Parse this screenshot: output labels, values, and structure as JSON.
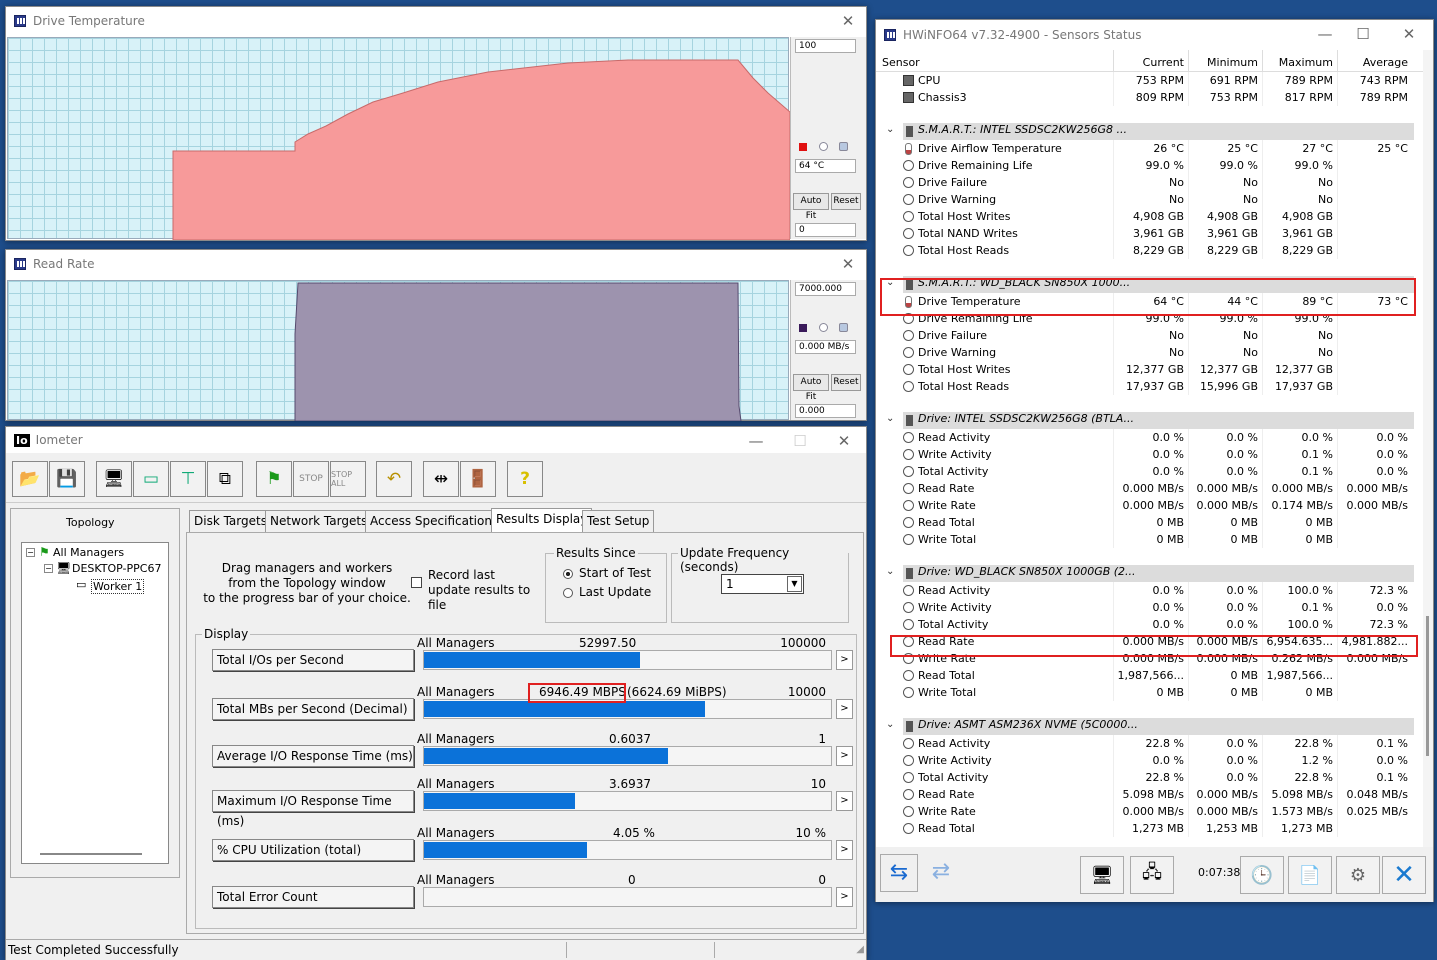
{
  "drive_temp": {
    "title": "Drive Temperature",
    "scale_max": "100",
    "scale_min": "0",
    "current": "64 °C",
    "auto_fit": "Auto Fit",
    "reset": "Reset",
    "color": "#f79a9a"
  },
  "read_rate": {
    "title": "Read Rate",
    "scale_max": "7000.000",
    "scale_min": "0.000",
    "current": "0.000 MB/s",
    "auto_fit": "Auto Fit",
    "reset": "Reset",
    "color": "#9d93ae"
  },
  "iometer": {
    "title": "Iometer",
    "logo": "Io",
    "topology_label": "Topology",
    "tree": [
      "All Managers",
      "DESKTOP-PPC67",
      "Worker 1"
    ],
    "tabs": [
      "Disk Targets",
      "Network Targets",
      "Access Specifications",
      "Results Display",
      "Test Setup"
    ],
    "drag_text": [
      "Drag managers and workers",
      "from the Topology window",
      "to the progress bar of your choice."
    ],
    "record_label": "Record last update results to file",
    "results_since_label": "Results Since",
    "start_label": "Start of Test",
    "last_update_label": "Last Update",
    "update_freq_label": "Update Frequency (seconds)",
    "update_freq_value": "1",
    "display_label": "Display",
    "status": "Test Completed Successfully",
    "metrics": [
      {
        "name": "Total I/Os per Second",
        "scope": "All Managers",
        "value": "52997.50",
        "max": "100000",
        "fill": 0.53
      },
      {
        "name": "Total MBs per Second (Decimal)",
        "scope": "All Managers",
        "value": "6946.49 MBPS",
        "extra": "(6624.69 MiBPS)",
        "max": "10000",
        "fill": 0.69
      },
      {
        "name": "Average I/O Response Time (ms)",
        "scope": "All Managers",
        "value": "0.6037",
        "max": "1",
        "fill": 0.6
      },
      {
        "name": "Maximum I/O Response Time (ms)",
        "scope": "All Managers",
        "value": "3.6937",
        "max": "10",
        "fill": 0.37
      },
      {
        "name": "% CPU Utilization (total)",
        "scope": "All Managers",
        "value": "4.05 %",
        "max": "10 %",
        "fill": 0.4
      },
      {
        "name": "Total Error Count",
        "scope": "All Managers",
        "value": "0",
        "max": "0",
        "fill": 0
      }
    ]
  },
  "hwinfo": {
    "title": "HWiNFO64 v7.32-4900 - Sensors Status",
    "columns": [
      "Sensor",
      "Current",
      "Minimum",
      "Maximum",
      "Average"
    ],
    "timer": "0:07:38",
    "rows": [
      {
        "t": "s",
        "n": "CPU",
        "v": [
          "753 RPM",
          "691 RPM",
          "789 RPM",
          "743 RPM"
        ],
        "i": "sq"
      },
      {
        "t": "s",
        "n": "Chassis3",
        "v": [
          "809 RPM",
          "753 RPM",
          "817 RPM",
          "789 RPM"
        ],
        "i": "sq"
      },
      {
        "t": "b"
      },
      {
        "t": "g",
        "n": "S.M.A.R.T.: INTEL SSDSC2KW256G8 ..."
      },
      {
        "t": "s",
        "n": "Drive Airflow Temperature",
        "v": [
          "26 °C",
          "25 °C",
          "27 °C",
          "25 °C"
        ],
        "i": "th"
      },
      {
        "t": "s",
        "n": "Drive Remaining Life",
        "v": [
          "99.0 %",
          "99.0 %",
          "99.0 %",
          ""
        ]
      },
      {
        "t": "s",
        "n": "Drive Failure",
        "v": [
          "No",
          "No",
          "No",
          ""
        ]
      },
      {
        "t": "s",
        "n": "Drive Warning",
        "v": [
          "No",
          "No",
          "No",
          ""
        ]
      },
      {
        "t": "s",
        "n": "Total Host Writes",
        "v": [
          "4,908 GB",
          "4,908 GB",
          "4,908 GB",
          ""
        ]
      },
      {
        "t": "s",
        "n": "Total NAND Writes",
        "v": [
          "3,961 GB",
          "3,961 GB",
          "3,961 GB",
          ""
        ]
      },
      {
        "t": "s",
        "n": "Total Host Reads",
        "v": [
          "8,229 GB",
          "8,229 GB",
          "8,229 GB",
          ""
        ]
      },
      {
        "t": "b"
      },
      {
        "t": "g",
        "n": "S.M.A.R.T.: WD_BLACK SN850X 1000..."
      },
      {
        "t": "s",
        "n": "Drive Temperature",
        "v": [
          "64 °C",
          "44 °C",
          "89 °C",
          "73 °C"
        ],
        "i": "th"
      },
      {
        "t": "s",
        "n": "Drive Remaining Life",
        "v": [
          "99.0 %",
          "99.0 %",
          "99.0 %",
          ""
        ]
      },
      {
        "t": "s",
        "n": "Drive Failure",
        "v": [
          "No",
          "No",
          "No",
          ""
        ]
      },
      {
        "t": "s",
        "n": "Drive Warning",
        "v": [
          "No",
          "No",
          "No",
          ""
        ]
      },
      {
        "t": "s",
        "n": "Total Host Writes",
        "v": [
          "12,377 GB",
          "12,377 GB",
          "12,377 GB",
          ""
        ]
      },
      {
        "t": "s",
        "n": "Total Host Reads",
        "v": [
          "17,937 GB",
          "15,996 GB",
          "17,937 GB",
          ""
        ]
      },
      {
        "t": "b"
      },
      {
        "t": "g",
        "n": "Drive: INTEL SSDSC2KW256G8 (BTLA..."
      },
      {
        "t": "s",
        "n": "Read Activity",
        "v": [
          "0.0 %",
          "0.0 %",
          "0.0 %",
          "0.0 %"
        ]
      },
      {
        "t": "s",
        "n": "Write Activity",
        "v": [
          "0.0 %",
          "0.0 %",
          "0.1 %",
          "0.0 %"
        ]
      },
      {
        "t": "s",
        "n": "Total Activity",
        "v": [
          "0.0 %",
          "0.0 %",
          "0.1 %",
          "0.0 %"
        ]
      },
      {
        "t": "s",
        "n": "Read Rate",
        "v": [
          "0.000 MB/s",
          "0.000 MB/s",
          "0.000 MB/s",
          "0.000 MB/s"
        ]
      },
      {
        "t": "s",
        "n": "Write Rate",
        "v": [
          "0.000 MB/s",
          "0.000 MB/s",
          "0.174 MB/s",
          "0.000 MB/s"
        ]
      },
      {
        "t": "s",
        "n": "Read Total",
        "v": [
          "0 MB",
          "0 MB",
          "0 MB",
          ""
        ]
      },
      {
        "t": "s",
        "n": "Write Total",
        "v": [
          "0 MB",
          "0 MB",
          "0 MB",
          ""
        ]
      },
      {
        "t": "b"
      },
      {
        "t": "g",
        "n": "Drive: WD_BLACK SN850X 1000GB (2..."
      },
      {
        "t": "s",
        "n": "Read Activity",
        "v": [
          "0.0 %",
          "0.0 %",
          "100.0 %",
          "72.3 %"
        ]
      },
      {
        "t": "s",
        "n": "Write Activity",
        "v": [
          "0.0 %",
          "0.0 %",
          "0.1 %",
          "0.0 %"
        ]
      },
      {
        "t": "s",
        "n": "Total Activity",
        "v": [
          "0.0 %",
          "0.0 %",
          "100.0 %",
          "72.3 %"
        ]
      },
      {
        "t": "s",
        "n": "Read Rate",
        "v": [
          "0.000 MB/s",
          "0.000 MB/s",
          "6,954.635...",
          "4,981.882..."
        ]
      },
      {
        "t": "s",
        "n": "Write Rate",
        "v": [
          "0.000 MB/s",
          "0.000 MB/s",
          "0.262 MB/s",
          "0.000 MB/s"
        ]
      },
      {
        "t": "s",
        "n": "Read Total",
        "v": [
          "1,987,566...",
          "0 MB",
          "1,987,566...",
          ""
        ]
      },
      {
        "t": "s",
        "n": "Write Total",
        "v": [
          "0 MB",
          "0 MB",
          "0 MB",
          ""
        ]
      },
      {
        "t": "b"
      },
      {
        "t": "g",
        "n": "Drive: ASMT ASM236X NVME (5C0000..."
      },
      {
        "t": "s",
        "n": "Read Activity",
        "v": [
          "22.8 %",
          "0.0 %",
          "22.8 %",
          "0.1 %"
        ]
      },
      {
        "t": "s",
        "n": "Write Activity",
        "v": [
          "0.0 %",
          "0.0 %",
          "1.2 %",
          "0.0 %"
        ]
      },
      {
        "t": "s",
        "n": "Total Activity",
        "v": [
          "22.8 %",
          "0.0 %",
          "22.8 %",
          "0.1 %"
        ]
      },
      {
        "t": "s",
        "n": "Read Rate",
        "v": [
          "5.098 MB/s",
          "0.000 MB/s",
          "5.098 MB/s",
          "0.048 MB/s"
        ]
      },
      {
        "t": "s",
        "n": "Write Rate",
        "v": [
          "0.000 MB/s",
          "0.000 MB/s",
          "1.573 MB/s",
          "0.025 MB/s"
        ]
      },
      {
        "t": "s",
        "n": "Read Total",
        "v": [
          "1,273 MB",
          "1,253 MB",
          "1,273 MB",
          ""
        ]
      }
    ]
  }
}
